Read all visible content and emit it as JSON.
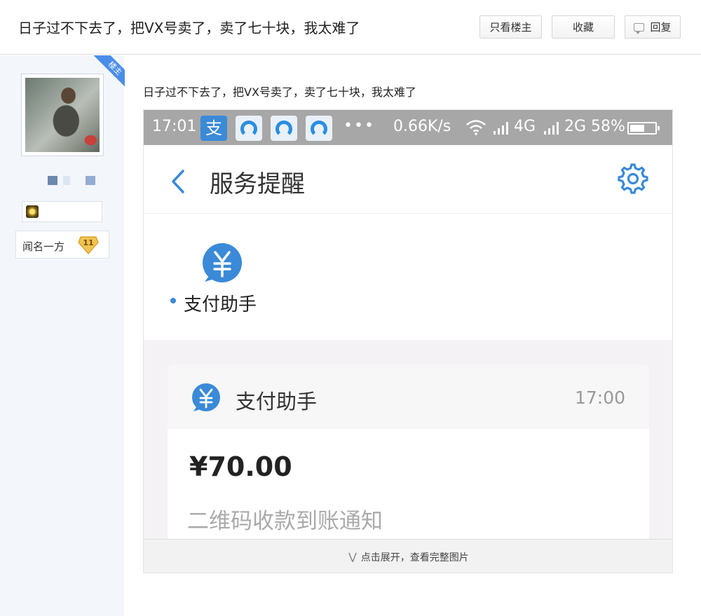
{
  "header": {
    "title": "日子过不下去了，把VX号卖了，卖了七十块，我太难了",
    "buttons": {
      "only_op": "只看楼主",
      "favorite": "收藏",
      "reply": "回复"
    }
  },
  "user": {
    "badge": "楼主",
    "level_name": "闻名一方",
    "level_number": "11"
  },
  "post": {
    "text": "日子过不下去了，把VX号卖了，卖了七十块，我太难了",
    "screenshot": {
      "status_bar": {
        "time": "17:01",
        "more": "•••",
        "speed": "0.66K/s",
        "signal_1": "4G",
        "signal_2": "2G",
        "battery": "58%",
        "battery_level": 0.58
      },
      "nav_title": "服务提醒",
      "sender": "支付助手",
      "card": {
        "sender": "支付助手",
        "time": "17:00",
        "amount": "¥70.00",
        "notice": "二维码收款到账通知"
      },
      "expand_label": "点击展开，查看完整图片"
    }
  },
  "colors": {
    "accent": "#3a8ad8",
    "sidebar_bg": "#f3f6fb",
    "badge_blue": "#4b8ee8",
    "level_gold": "#f0c452"
  },
  "icons": [
    "reply-icon",
    "alipay-icon",
    "q-app-icon",
    "wifi-icon",
    "signal-icon",
    "battery-icon",
    "back-icon",
    "gear-icon",
    "yuan-icon",
    "chevron-down-icon",
    "medal-icon",
    "level-badge-icon"
  ]
}
